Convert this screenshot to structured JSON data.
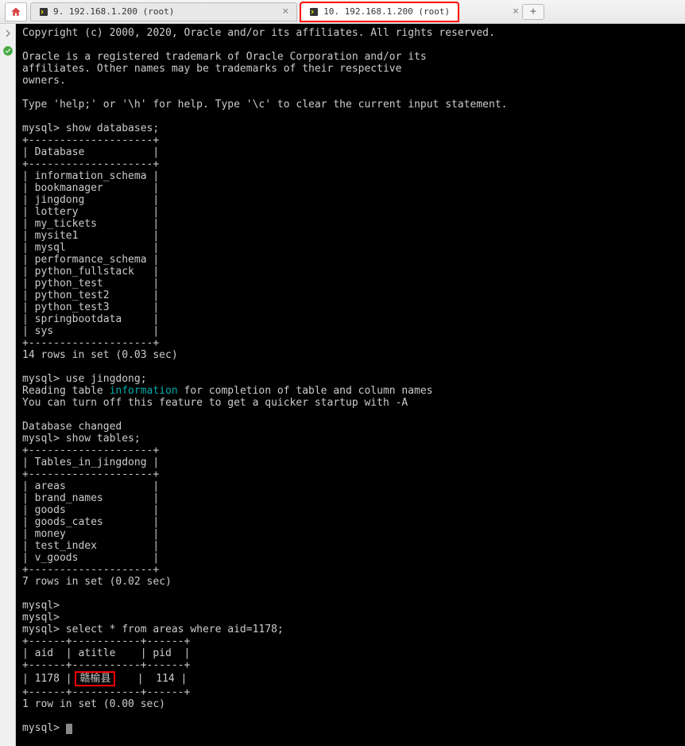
{
  "tabs": {
    "tab1_label": "9. 192.168.1.200 (root)",
    "tab2_label": "10. 192.168.1.200 (root)"
  },
  "terminal": {
    "copyright": "Copyright (c) 2000, 2020, Oracle and/or its affiliates. All rights reserved.",
    "trademark1": "Oracle is a registered trademark of Oracle Corporation and/or its",
    "trademark2": "affiliates. Other names may be trademarks of their respective",
    "trademark3": "owners.",
    "help": "Type 'help;' or '\\h' for help. Type '\\c' to clear the current input statement.",
    "prompt1": "mysql> show databases;",
    "db_border": "+--------------------+",
    "db_header": "| Database           |",
    "databases": [
      "| information_schema |",
      "| bookmanager        |",
      "| jingdong           |",
      "| lottery            |",
      "| my_tickets         |",
      "| mysite1            |",
      "| mysql              |",
      "| performance_schema |",
      "| python_fullstack   |",
      "| python_test        |",
      "| python_test2       |",
      "| python_test3       |",
      "| springbootdata     |",
      "| sys                |"
    ],
    "db_result": "14 rows in set (0.03 sec)",
    "prompt2": "mysql> use jingdong;",
    "reading1": "Reading table ",
    "reading_kw": "information",
    "reading2": " for completion of table and column names",
    "turnoff": "You can turn off this feature to get a quicker startup with -A",
    "dbchanged": "Database changed",
    "prompt3": "mysql> show tables;",
    "tbl_border": "+--------------------+",
    "tbl_header": "| Tables_in_jingdong |",
    "tables": [
      "| areas              |",
      "| brand_names        |",
      "| goods              |",
      "| goods_cates        |",
      "| money              |",
      "| test_index         |",
      "| v_goods            |"
    ],
    "tbl_result": "7 rows in set (0.02 sec)",
    "empty_prompt": "mysql>",
    "prompt4": "mysql> select * from areas where aid=1178;",
    "area_border": "+------+-----------+------+",
    "area_header": "| aid  | atitle    | pid  |",
    "area_row_p1": "| 1178 | ",
    "area_row_hl": "赣榆县",
    "area_row_p2": "    |  114 |",
    "area_result": "1 row in set (0.00 sec)",
    "final_prompt": "mysql> "
  }
}
